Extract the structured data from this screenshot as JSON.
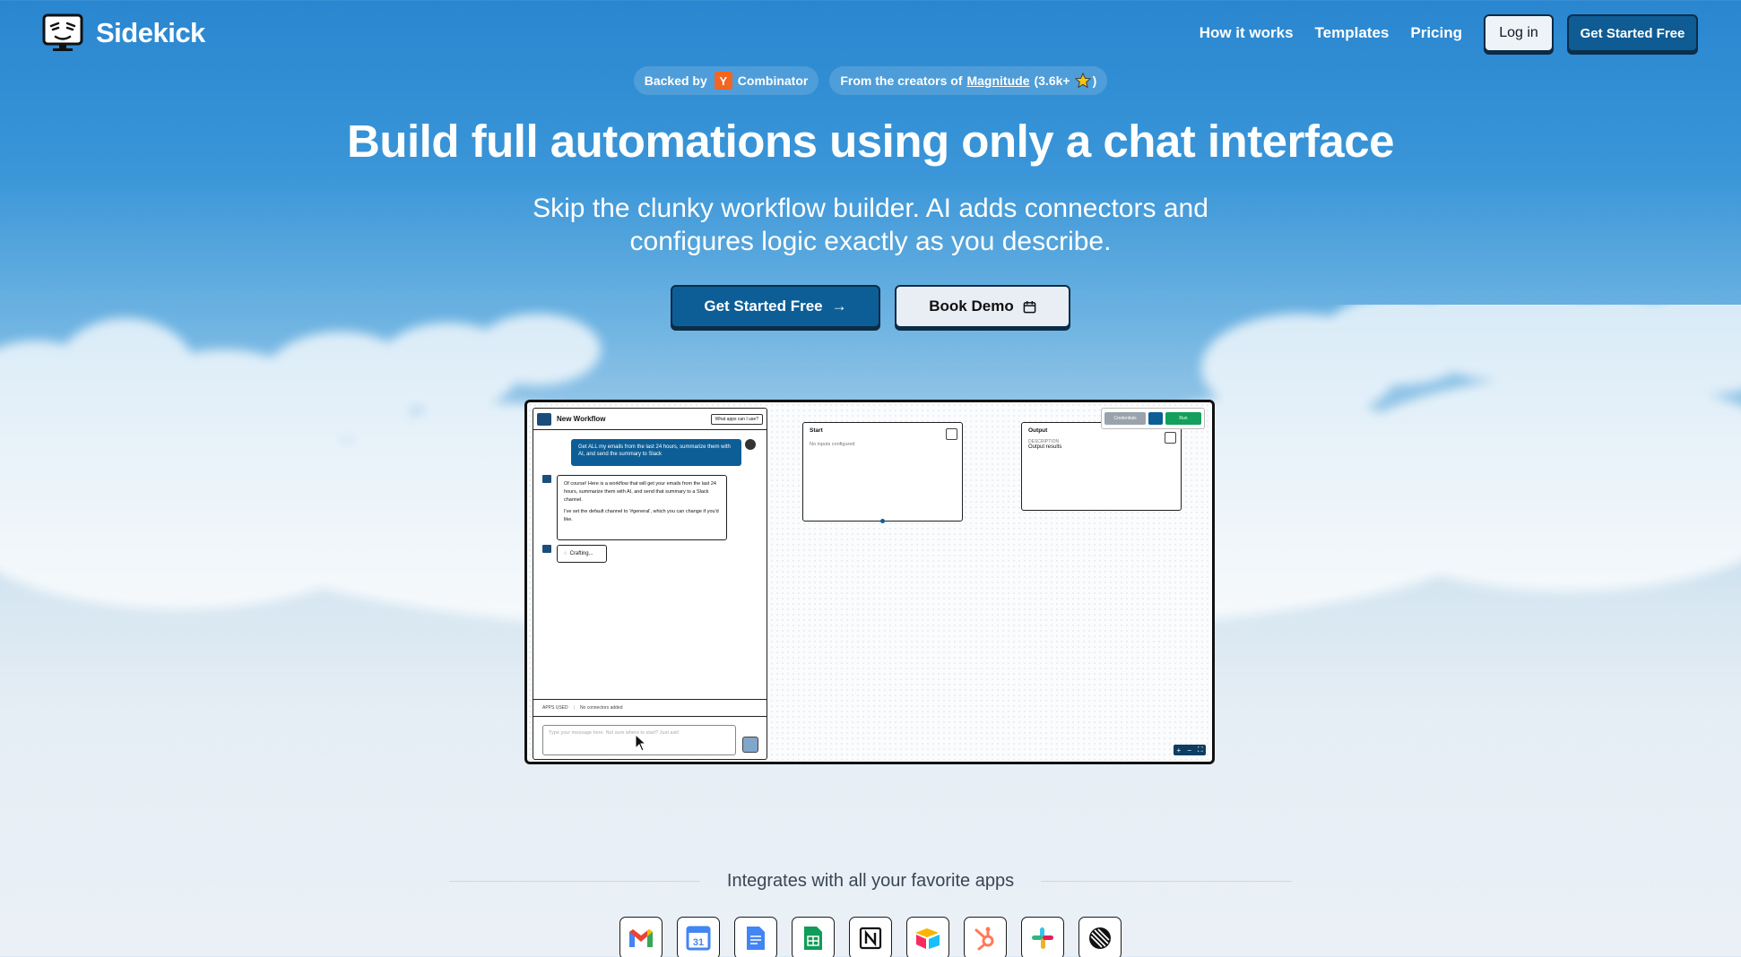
{
  "nav": {
    "brand": "Sidekick",
    "links": [
      "How it works",
      "Templates",
      "Pricing"
    ],
    "login": "Log in",
    "cta": "Get Started Free"
  },
  "badges": {
    "backed_prefix": "Backed by",
    "yc_letter": "Y",
    "yc_name": "Combinator",
    "creators_prefix": "From the creators of",
    "creators_link": "Magnitude",
    "creators_stars": "(3.6k+",
    "creators_close": ")"
  },
  "hero": {
    "title": "Build full automations using only a chat interface",
    "subtitle": "Skip the clunky workflow builder. AI adds connectors and configures logic exactly as you describe.",
    "cta_primary": "Get Started Free",
    "cta_primary_arrow": "→",
    "cta_secondary": "Book Demo"
  },
  "demo": {
    "chat_title": "New Workflow",
    "chat_help": "What apps can I use?",
    "user_message": "Get ALL my emails from the last 24 hours, summarize them with AI, and send the summary to Slack",
    "bot_message_1": "Of course! Here is a workflow that will get your emails from the last 24 hours, summarize them with AI, and send that summary to a Slack channel.",
    "bot_message_2": "I've set the default channel to '#general', which you can change if you'd like.",
    "crafting": "Crafting...",
    "apps_used_label": "APPS USED",
    "apps_used_value": "No connectors added",
    "input_placeholder": "Type your message here. Not sure where to start? Just ask!",
    "start_node": {
      "title": "Start",
      "body": "No inputs configured"
    },
    "output_node": {
      "title": "Output",
      "label": "DESCRIPTION",
      "body": "Output results"
    },
    "toolbar": {
      "credentials": "Credentials",
      "run": "Run"
    },
    "zoom": [
      "+",
      "−",
      "⛶"
    ]
  },
  "integrations": {
    "title": "Integrates with all your favorite apps",
    "apps": [
      "gmail-icon",
      "google-calendar-icon",
      "google-docs-icon",
      "google-sheets-icon",
      "notion-icon",
      "airtable-icon",
      "hubspot-icon",
      "slack-icon",
      "linear-icon"
    ]
  },
  "colors": {
    "primary": "#0d5e96",
    "border": "#0b2c47",
    "sky_top": "#2a86cf",
    "yc_orange": "#f26522",
    "run_green": "#12a05a"
  }
}
